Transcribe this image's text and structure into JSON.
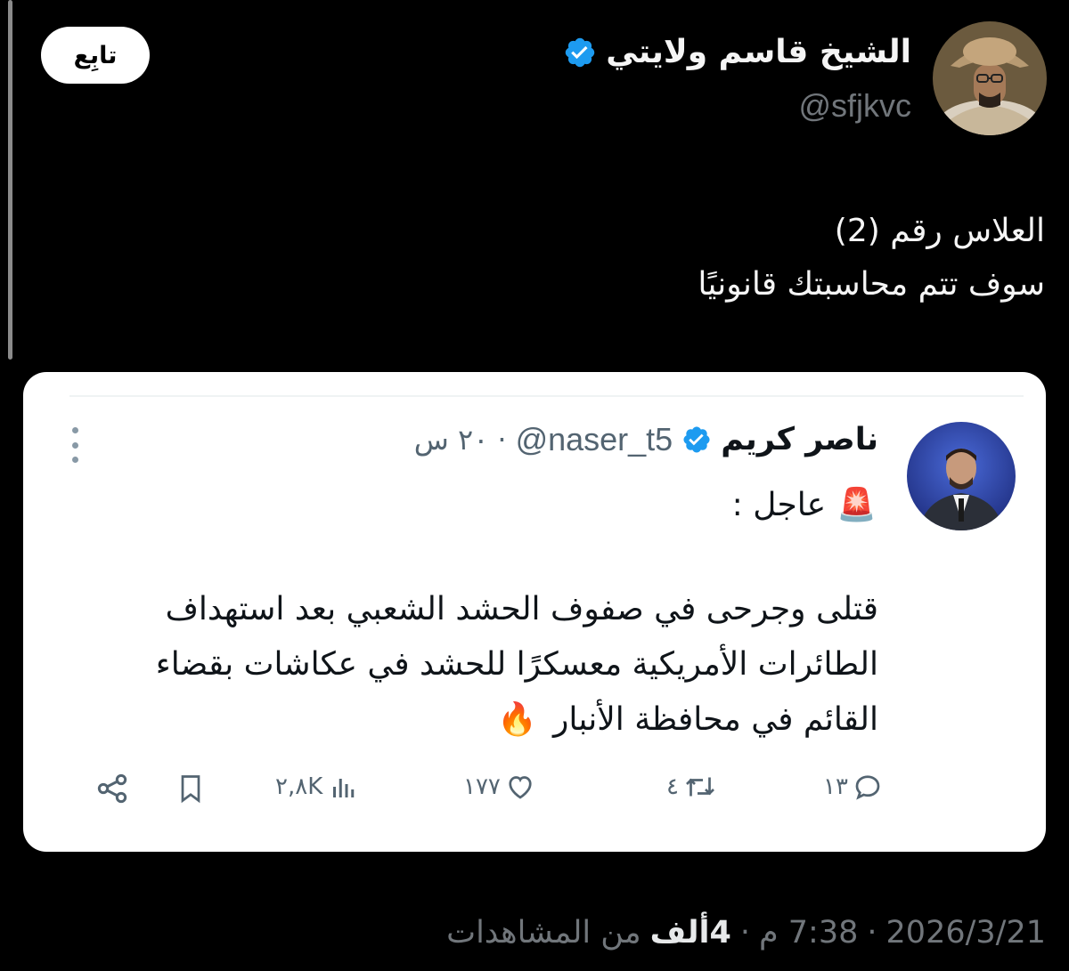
{
  "author": {
    "display_name": "الشيخ قاسم ولايتي",
    "handle": "@sfjkvc",
    "verified": true
  },
  "follow_button": {
    "label": "تابِع"
  },
  "tweet": {
    "lines": [
      "العلاس رقم (2)",
      "سوف تتم محاسبتك قانونيًا"
    ]
  },
  "quoted_tweet": {
    "author_name": "ناصر كريم",
    "handle": "@naser_t5",
    "separator": "·",
    "time": "٢٠ س",
    "urgent_emoji": "🚨",
    "urgent_label": "عاجل :",
    "body_lines": [
      "قتلى وجرحى في صفوف الحشد الشعبي بعد استهداف",
      "الطائرات الأمريكية معسكرًا للحشد في عكاشات بقضاء",
      "القائم في محافظة الأنبار"
    ],
    "body_emoji": "🔥",
    "actions": {
      "replies": "١٣",
      "reposts": "٤",
      "likes": "١٧٧",
      "views": "٢,٨K"
    }
  },
  "footer": {
    "date": "2026/3/21",
    "sep1": "·",
    "time": "7:38 م",
    "sep2": "·",
    "views_count": "4ألف",
    "views_label": "من المشاهدات"
  },
  "colors": {
    "background": "#000000",
    "verified_blue": "#1d9bf0",
    "muted_text": "#71767b",
    "card_bg": "#ffffff"
  },
  "icons": {
    "verified": "verified-badge-icon",
    "more": "more-vertical-icon",
    "reply": "reply-icon",
    "repost": "repost-icon",
    "like": "heart-icon",
    "views": "views-chart-icon",
    "bookmark": "bookmark-icon",
    "share": "share-icon"
  }
}
